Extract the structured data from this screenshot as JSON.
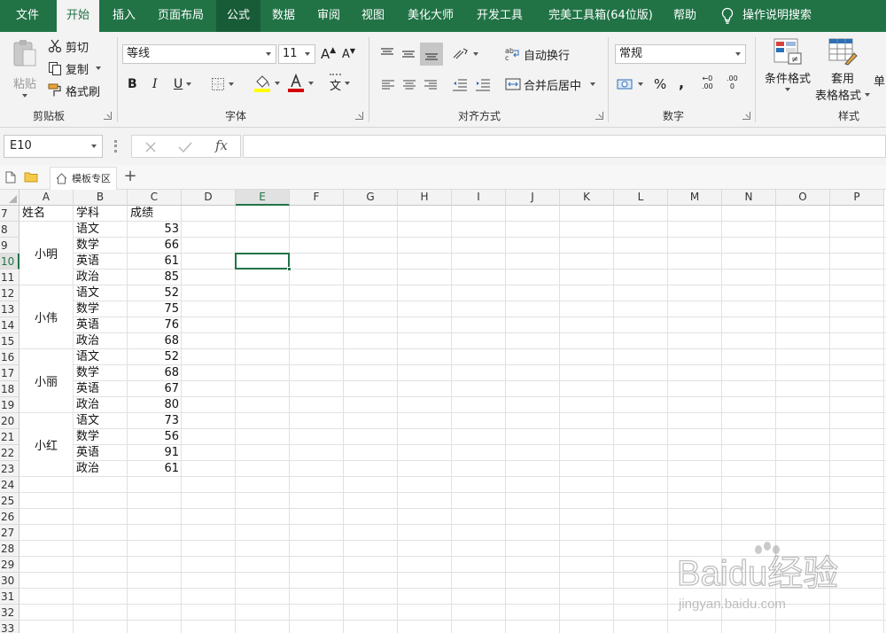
{
  "menu": {
    "tabs": [
      "文件",
      "开始",
      "插入",
      "页面布局",
      "公式",
      "数据",
      "审阅",
      "视图",
      "美化大师",
      "开发工具",
      "完美工具箱(64位版)",
      "帮助"
    ],
    "active_index": 1,
    "search_label": "操作说明搜索"
  },
  "ribbon": {
    "clipboard": {
      "paste": "粘贴",
      "cut": "剪切",
      "copy": "复制",
      "format_painter": "格式刷",
      "label": "剪贴板"
    },
    "font": {
      "font_name": "等线",
      "font_size": "11",
      "bold": "B",
      "italic": "I",
      "underline": "U",
      "grow": "A",
      "shrink": "A",
      "wen": "文",
      "label": "字体",
      "fill_color": "#ffff00",
      "font_color": "#d40000"
    },
    "alignment": {
      "wrap": "自动换行",
      "merge": "合并后居中",
      "label": "对齐方式"
    },
    "number": {
      "format": "常规",
      "percent": "%",
      "comma": ",",
      "inc_decimal": ".00",
      "dec_decimal": "0",
      "label": "数字"
    },
    "styles": {
      "conditional": "条件格式",
      "table_fmt_1": "套用",
      "table_fmt_2": "表格格式",
      "cell_styles": "单",
      "label": "样式"
    }
  },
  "formula_bar": {
    "name_box": "E10",
    "fx": "fx",
    "formula": ""
  },
  "doc_tabs": {
    "template_zone": "模板专区"
  },
  "sheet": {
    "columns": [
      "A",
      "B",
      "C",
      "D",
      "E",
      "F",
      "G",
      "H",
      "I",
      "J",
      "K",
      "L",
      "M",
      "N",
      "O",
      "P"
    ],
    "rows": [
      "7",
      "8",
      "9",
      "10",
      "11",
      "12",
      "13",
      "14",
      "15",
      "16",
      "17",
      "18",
      "19",
      "20",
      "21",
      "22",
      "23",
      "24",
      "25",
      "26",
      "27",
      "28",
      "29",
      "30",
      "31",
      "32",
      "33"
    ],
    "selected_cell": "E10",
    "headers": {
      "name": "姓名",
      "subject": "学科",
      "score": "成绩"
    },
    "students": [
      {
        "name": "小明",
        "records": [
          {
            "subject": "语文",
            "score": "53"
          },
          {
            "subject": "数学",
            "score": "66"
          },
          {
            "subject": "英语",
            "score": "61"
          },
          {
            "subject": "政治",
            "score": "85"
          }
        ]
      },
      {
        "name": "小伟",
        "records": [
          {
            "subject": "语文",
            "score": "52"
          },
          {
            "subject": "数学",
            "score": "75"
          },
          {
            "subject": "英语",
            "score": "76"
          },
          {
            "subject": "政治",
            "score": "68"
          }
        ]
      },
      {
        "name": "小丽",
        "records": [
          {
            "subject": "语文",
            "score": "52"
          },
          {
            "subject": "数学",
            "score": "68"
          },
          {
            "subject": "英语",
            "score": "67"
          },
          {
            "subject": "政治",
            "score": "80"
          }
        ]
      },
      {
        "name": "小红",
        "records": [
          {
            "subject": "语文",
            "score": "73"
          },
          {
            "subject": "数学",
            "score": "56"
          },
          {
            "subject": "英语",
            "score": "91"
          },
          {
            "subject": "政治",
            "score": "61"
          }
        ]
      }
    ]
  },
  "watermark": {
    "brand": "Baidu经验",
    "url": "jingyan.baidu.com"
  },
  "colors": {
    "accent": "#217346",
    "tab_bar": "#217346",
    "ribbon_bg": "#f3f3f3"
  }
}
